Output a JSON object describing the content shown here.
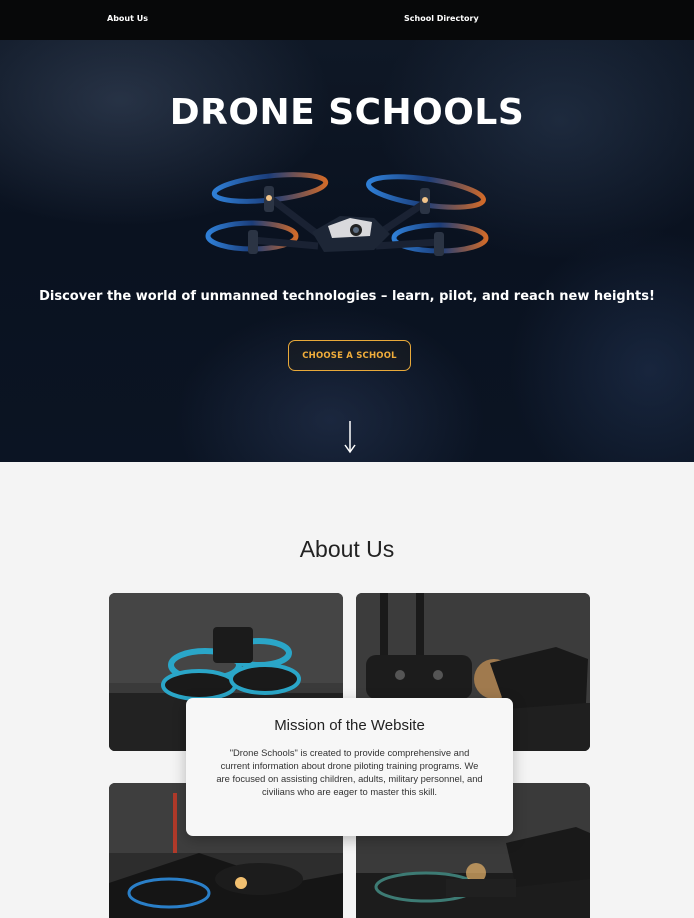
{
  "nav": {
    "about_label": "About Us",
    "directory_label": "School Directory"
  },
  "hero": {
    "title": "DRONE SCHOOLS",
    "subtitle": "Discover the world of unmanned technologies – learn, pilot, and reach new heights!",
    "cta_label": "CHOOSE A SCHOOL",
    "accent_color": "#f0ad3b"
  },
  "about": {
    "title": "About Us",
    "mission_title": "Mission of the Website",
    "mission_text": "\"Drone Schools\" is created to provide comprehensive and current information about drone piloting training programs. We are focused on assisting children, adults, military personnel, and civilians who are eager to master this skill."
  },
  "icons": [
    "down-arrow-icon"
  ]
}
